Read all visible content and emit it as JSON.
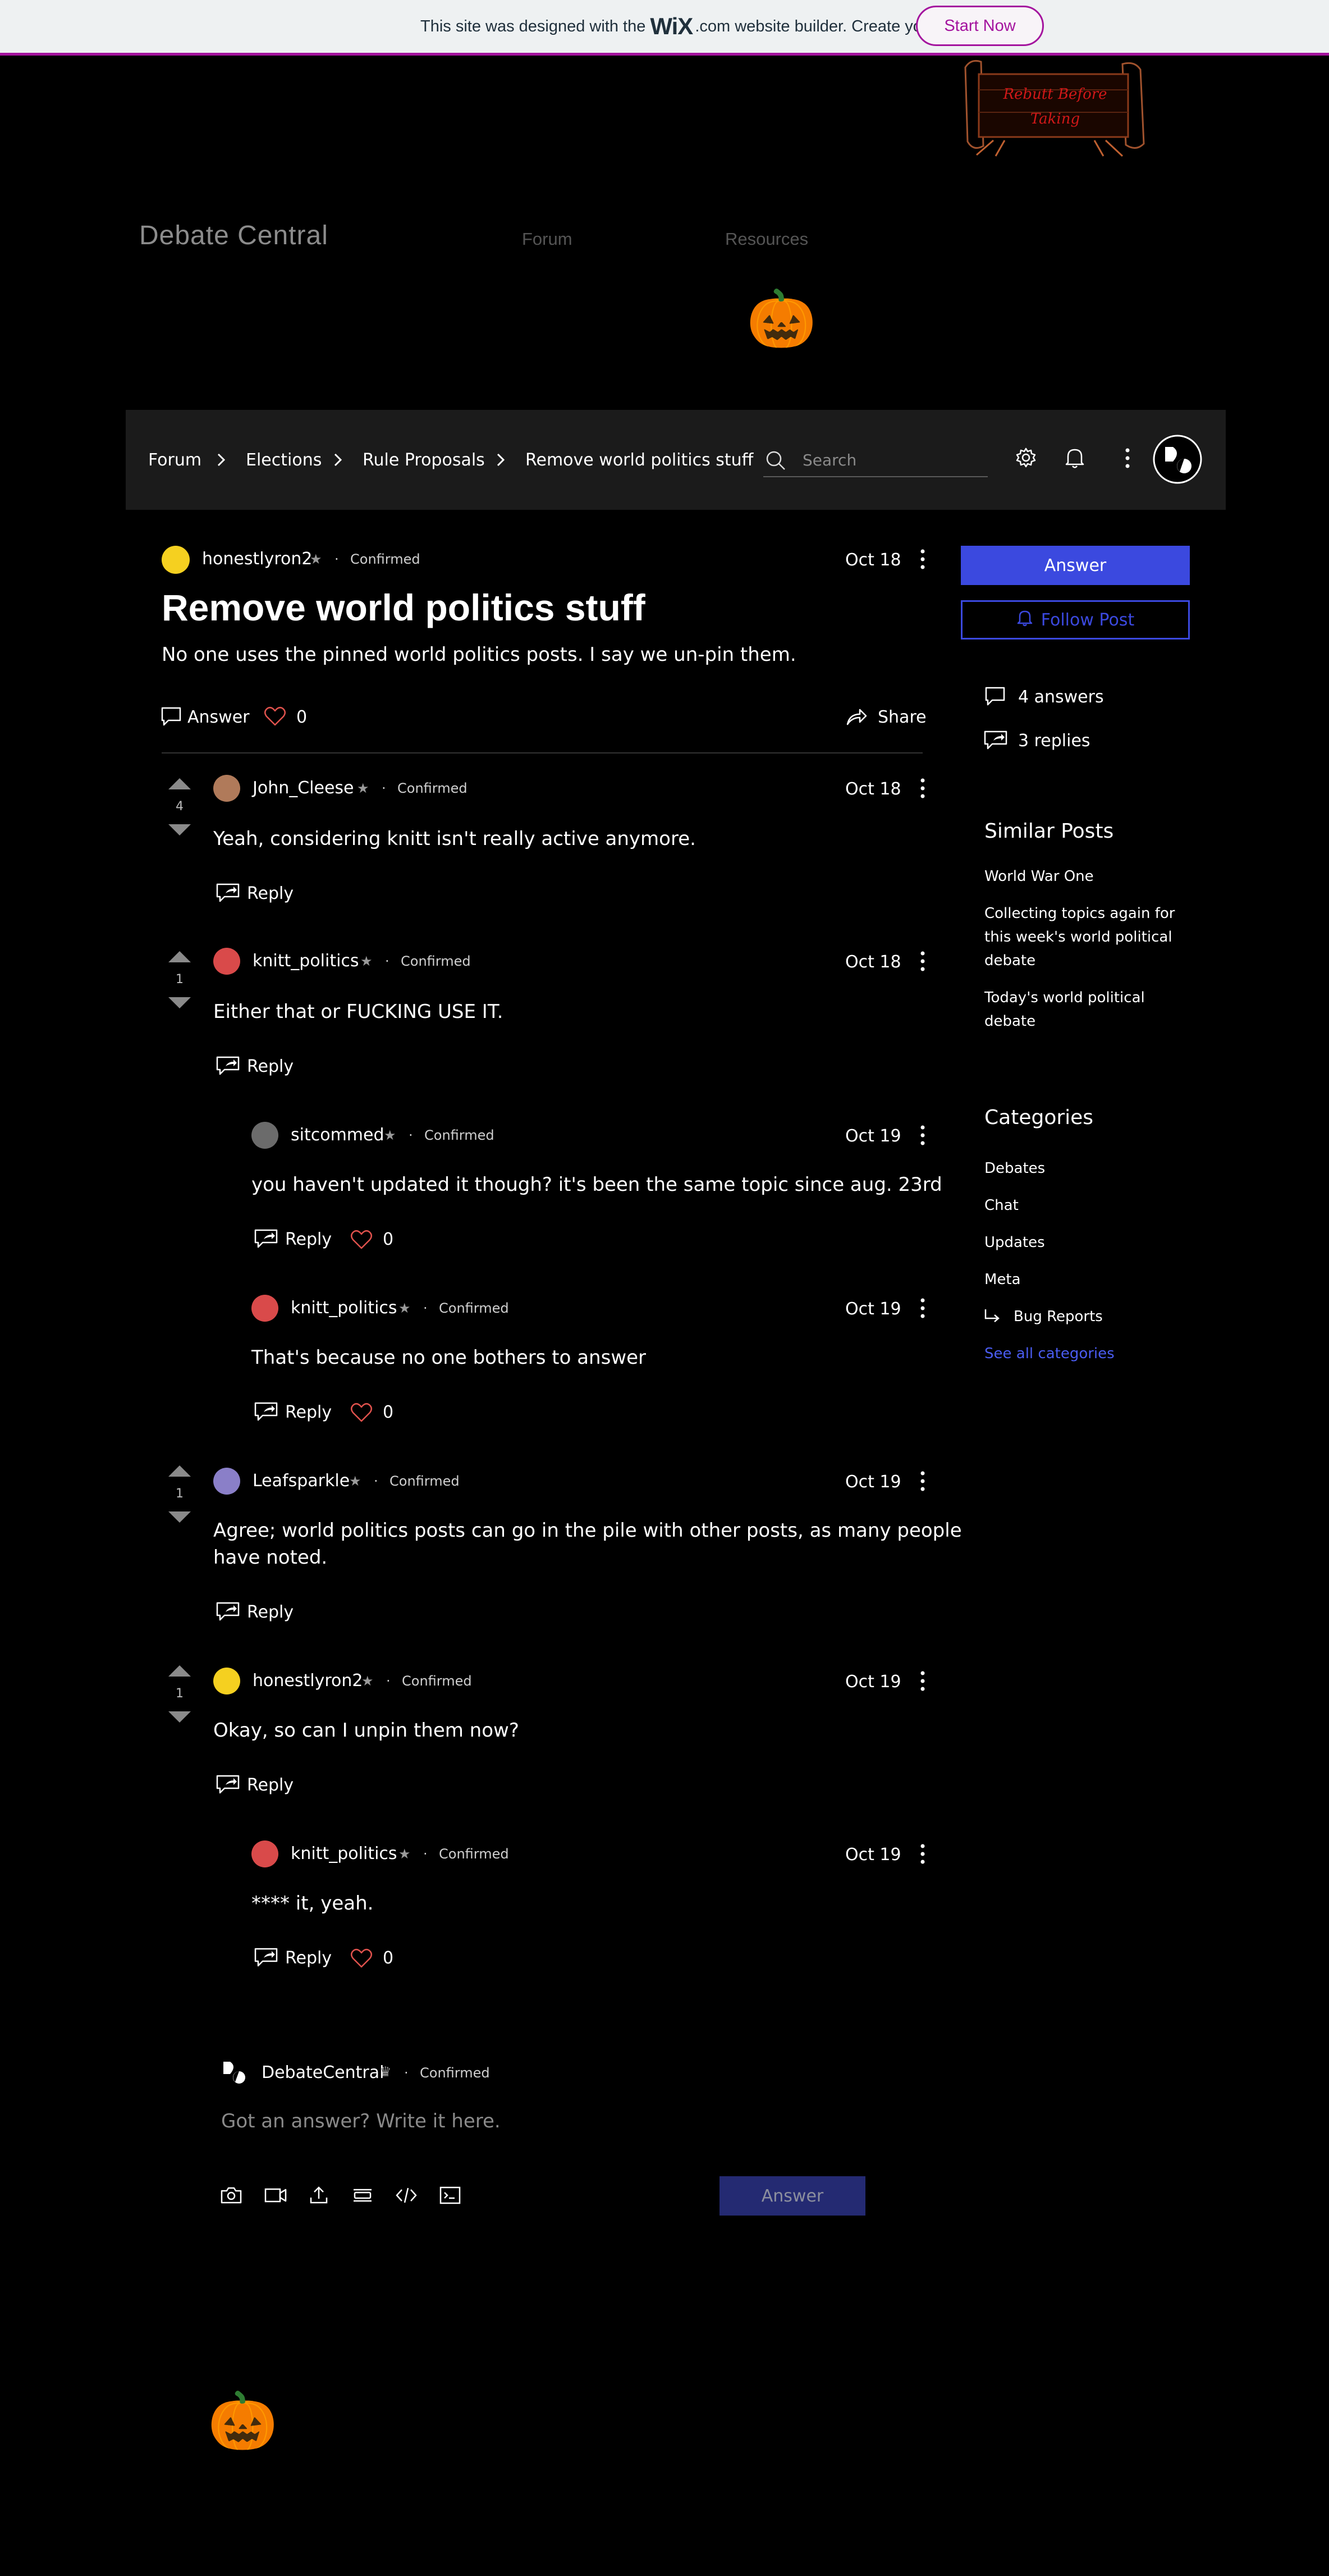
{
  "banner": {
    "text_before": "This site was designed with the",
    "logo": "WiX",
    "text_after": ".com website builder. Create your website today.",
    "cta": "Start Now",
    "accent": "#a4139e"
  },
  "site": {
    "name": "Debate Central",
    "nav": [
      "Forum",
      "Resources"
    ],
    "logo_text": [
      "Rebutt Before",
      "Taking"
    ],
    "decor": "🎃"
  },
  "toolbar": {
    "breadcrumbs": [
      "Forum",
      "Elections",
      "Rule Proposals",
      "Remove world politics stuff"
    ],
    "search_placeholder": "Search",
    "icons": [
      "settings-icon",
      "bell-icon",
      "more-icon",
      "avatar"
    ]
  },
  "post": {
    "author": "honestlyron2",
    "badge": "Confirmed",
    "date": "Oct 18",
    "title": "Remove world politics stuff",
    "body": "No one uses the pinned world politics posts. I say we un-pin them.",
    "answer_label": "Answer",
    "likes": "0",
    "share_label": "Share"
  },
  "answers": [
    {
      "author": "John_Cleese",
      "badge": "Confirmed",
      "date": "Oct 18",
      "votes": "4",
      "body": "Yeah, considering knitt isn't really active anymore.",
      "reply_label": "Reply",
      "avatar_color": "#b07a5a"
    },
    {
      "author": "knitt_politics",
      "badge": "Confirmed",
      "date": "Oct 18",
      "votes": "1",
      "body": "Either that or FUCKING USE IT.",
      "reply_label": "Reply",
      "avatar_color": "#d94a4a",
      "replies": [
        {
          "author": "sitcommed",
          "badge": "Confirmed",
          "date": "Oct 19",
          "body": "you haven't updated it though? it's been the same topic since aug. 23rd",
          "reply_label": "Reply",
          "likes": "0",
          "avatar_color": "#6b6b6b"
        },
        {
          "author": "knitt_politics",
          "badge": "Confirmed",
          "date": "Oct 19",
          "body": "That's because no one bothers to answer",
          "reply_label": "Reply",
          "likes": "0",
          "avatar_color": "#d94a4a"
        }
      ]
    },
    {
      "author": "Leafsparkle",
      "badge": "Confirmed",
      "date": "Oct 19",
      "votes": "1",
      "body_lines": [
        "Agree; world politics posts can go in the pile with other posts, as many people",
        "have noted."
      ],
      "reply_label": "Reply",
      "avatar_color": "#8a7fc8"
    },
    {
      "author": "honestlyron2",
      "badge": "Confirmed",
      "date": "Oct 19",
      "votes": "1",
      "body": "Okay, so can I unpin them now?",
      "reply_label": "Reply",
      "avatar_color": "#f5d020",
      "replies": [
        {
          "author": "knitt_politics",
          "badge": "Confirmed",
          "date": "Oct 19",
          "body": "**** it, yeah.",
          "reply_label": "Reply",
          "likes": "0",
          "avatar_color": "#d94a4a"
        }
      ]
    }
  ],
  "composer": {
    "author": "DebateCentral",
    "badge": "Confirmed",
    "placeholder": "Got an answer? Write it here.",
    "submit_label": "Answer",
    "tools": [
      "camera-icon",
      "video-icon",
      "upload-icon",
      "divider-icon",
      "code-icon",
      "embed-icon"
    ]
  },
  "sidebar": {
    "answer_button": "Answer",
    "follow_button": "Follow Post",
    "stats": {
      "answers": "4 answers",
      "replies": "3 replies"
    },
    "similar_title": "Similar Posts",
    "similar_posts": [
      [
        "World War One"
      ],
      [
        "Collecting topics again for",
        "this week's world political",
        "debate"
      ],
      [
        "Today's world political",
        "debate"
      ]
    ],
    "categories_title": "Categories",
    "categories": [
      "Debates",
      "Chat",
      "Updates",
      "Meta",
      "Bug Reports"
    ],
    "see_all": "See all categories"
  },
  "colors": {
    "primary": "#3b49df",
    "like": "#e0524d",
    "background": "#000000",
    "toolbar": "#1b1b1b"
  }
}
